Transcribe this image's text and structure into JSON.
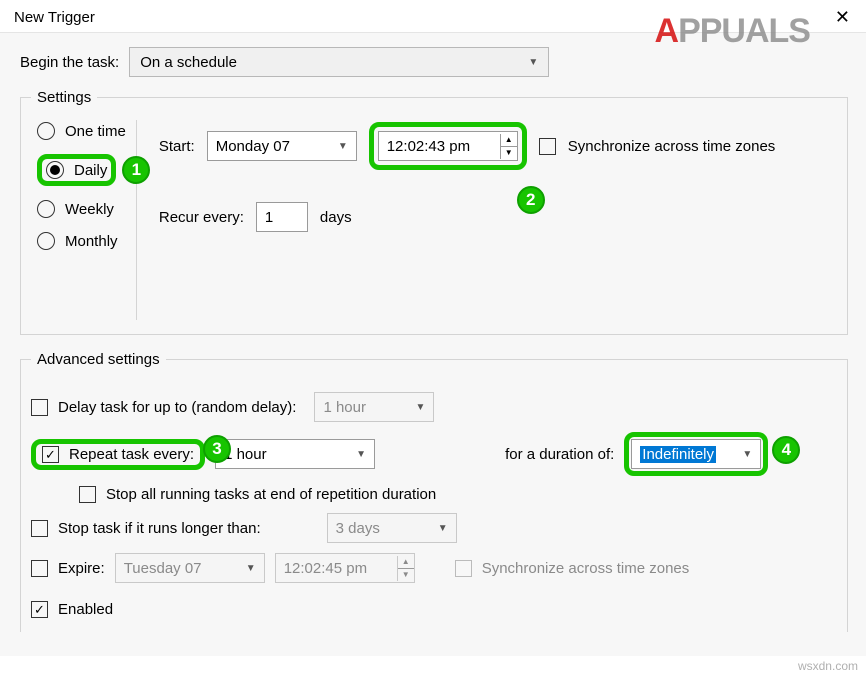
{
  "title": "New Trigger",
  "beginTaskLabel": "Begin the task:",
  "beginTaskValue": "On a schedule",
  "settings": {
    "legend": "Settings",
    "freq": {
      "oneTime": "One time",
      "daily": "Daily",
      "weekly": "Weekly",
      "monthly": "Monthly"
    },
    "startLabel": "Start:",
    "startDate": "Monday    07",
    "startTime": "12:02:43 pm",
    "syncLabel": "Synchronize across time zones",
    "recurLabel": "Recur every:",
    "recurValue": "1",
    "recurUnit": "days"
  },
  "advanced": {
    "legend": "Advanced settings",
    "delayLabel": "Delay task for up to (random delay):",
    "delayValue": "1 hour",
    "repeatLabel": "Repeat task every:",
    "repeatValue": "1 hour",
    "durationLabel": "for a duration of:",
    "durationValue": "Indefinitely",
    "stopAllLabel": "Stop all running tasks at end of repetition duration",
    "stopIfLabel": "Stop task if it runs longer than:",
    "stopIfValue": "3 days",
    "expireLabel": "Expire:",
    "expireDate": "Tuesday    07",
    "expireTime": "12:02:45 pm",
    "expireSyncLabel": "Synchronize across time zones",
    "enabledLabel": "Enabled"
  },
  "watermark": {
    "prefix": "A",
    "rest": "PPUALS",
    "url": "wsxdn.com"
  }
}
